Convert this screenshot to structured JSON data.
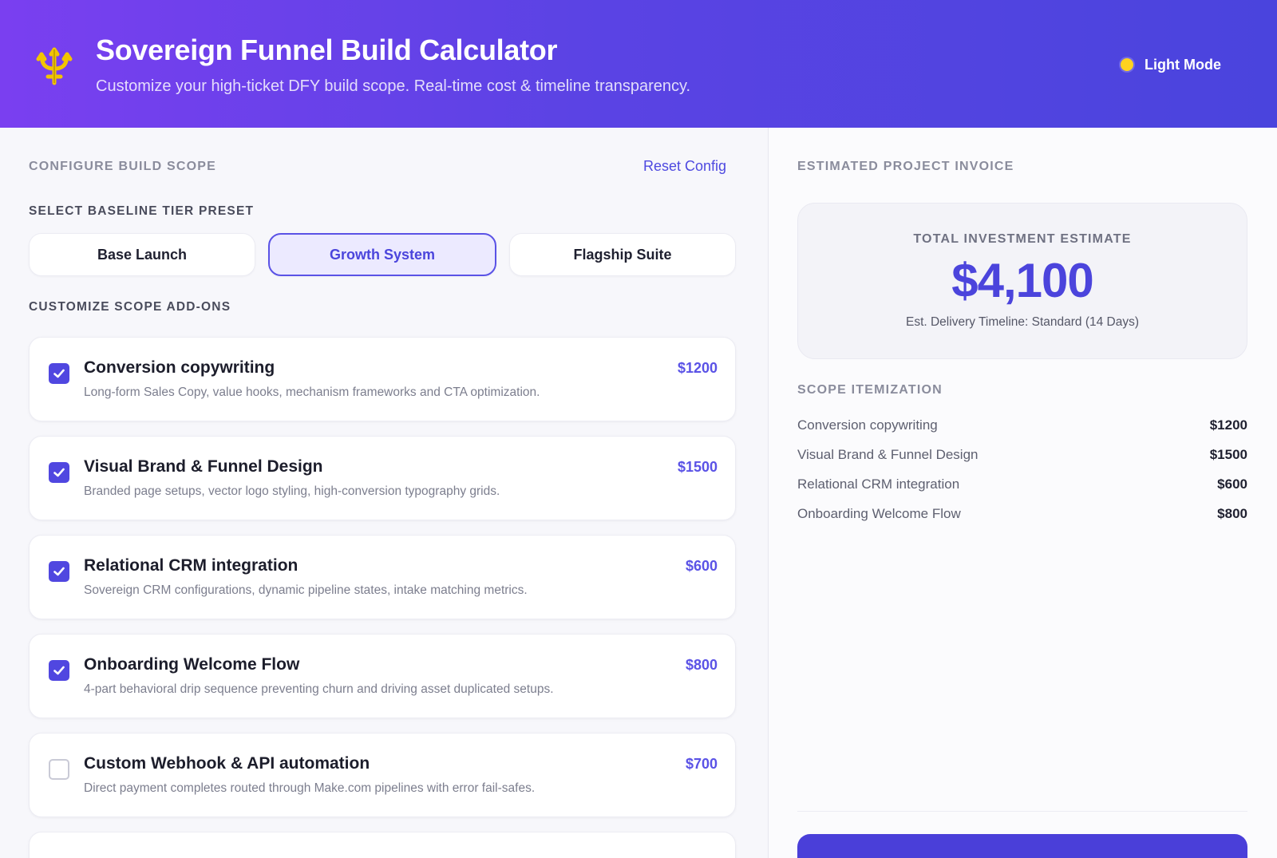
{
  "header": {
    "title": "Sovereign Funnel Build Calculator",
    "subtitle": "Customize your high-ticket DFY build scope. Real-time cost & timeline transparency.",
    "mode_label": "Light Mode"
  },
  "configure": {
    "heading": "CONFIGURE BUILD SCOPE",
    "reset_label": "Reset Config",
    "tier_heading": "SELECT BASELINE TIER PRESET",
    "tiers": [
      {
        "label": "Base Launch",
        "active": false
      },
      {
        "label": "Growth System",
        "active": true
      },
      {
        "label": "Flagship Suite",
        "active": false
      }
    ],
    "addons_heading": "CUSTOMIZE SCOPE ADD-ONS",
    "addons": [
      {
        "name": "Conversion copywriting",
        "desc": "Long-form Sales Copy, value hooks, mechanism frameworks and CTA optimization.",
        "price": "$1200",
        "checked": true
      },
      {
        "name": "Visual Brand & Funnel Design",
        "desc": "Branded page setups, vector logo styling, high-conversion typography grids.",
        "price": "$1500",
        "checked": true
      },
      {
        "name": "Relational CRM integration",
        "desc": "Sovereign CRM configurations, dynamic pipeline states, intake matching metrics.",
        "price": "$600",
        "checked": true
      },
      {
        "name": "Onboarding Welcome Flow",
        "desc": "4-part behavioral drip sequence preventing churn and driving asset duplicated setups.",
        "price": "$800",
        "checked": true
      },
      {
        "name": "Custom Webhook & API automation",
        "desc": "Direct payment completes routed through Make.com pipelines with error fail-safes.",
        "price": "$700",
        "checked": false
      }
    ]
  },
  "invoice": {
    "heading": "ESTIMATED PROJECT INVOICE",
    "total_label": "TOTAL INVESTMENT ESTIMATE",
    "total_amount": "$4,100",
    "timeline": "Est. Delivery Timeline: Standard (14 Days)",
    "itemization_heading": "SCOPE ITEMIZATION",
    "items": [
      {
        "name": "Conversion copywriting",
        "price": "$1200"
      },
      {
        "name": "Visual Brand & Funnel Design",
        "price": "$1500"
      },
      {
        "name": "Relational CRM integration",
        "price": "$600"
      },
      {
        "name": "Onboarding Welcome Flow",
        "price": "$800"
      }
    ]
  },
  "icons": {
    "logo": "trident-icon",
    "mode": "sun-dot-icon",
    "check": "checkmark-icon"
  },
  "colors": {
    "accent": "#5047e0",
    "header_start": "#7a3ff0",
    "header_end": "#4a44dd",
    "mode_dot": "#ffd21f",
    "logo": "#f2c400"
  }
}
